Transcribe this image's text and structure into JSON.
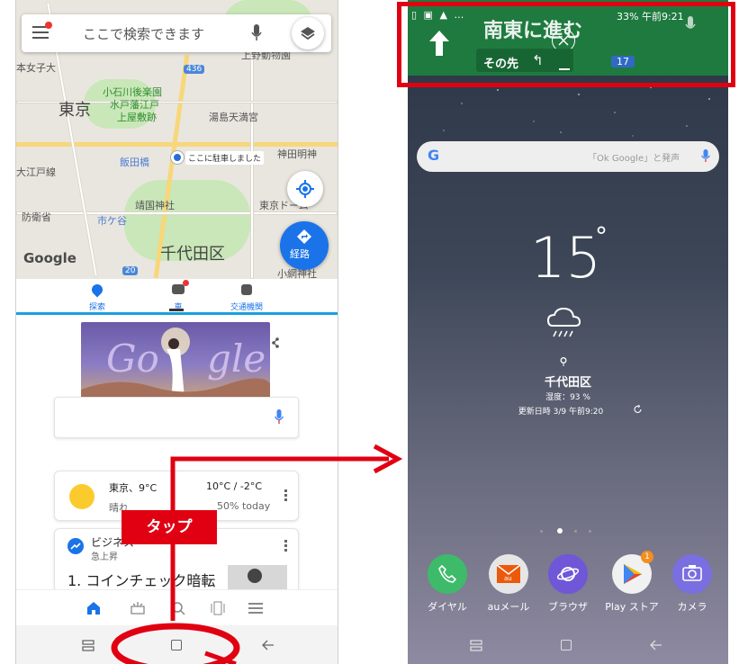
{
  "maps": {
    "search_placeholder": "ここで検索できます",
    "labels": {
      "tokyo": "東京",
      "chiyoda": "千代田区",
      "koishikawa": "小石川後楽園",
      "mito": "水戸藩江戸",
      "yashiki": "上屋敷跡",
      "yushima": "湯島天満宮",
      "kanda": "神田明神",
      "parked": "ここに駐車しました",
      "yasukuni": "靖国神社",
      "tokyo_dome": "東京ドーム",
      "boeisho": "防衛省",
      "ichigaya": "市ケ谷",
      "iidabashi": "飯田橋",
      "oedo": "大江戸線",
      "ueno": "上野動物園",
      "joshi": "本女子大",
      "obanashi": "小網神社",
      "route_436": "436",
      "route_20": "20",
      "google": "Google",
      "directions": "経路"
    },
    "tabs": [
      {
        "label": "探索",
        "icon": "explore-icon",
        "color": "#1a73e8"
      },
      {
        "label": "車",
        "icon": "car-icon",
        "color": "#1a73e8"
      },
      {
        "label": "交通機関",
        "icon": "transit-icon",
        "color": "#1a73e8"
      }
    ]
  },
  "google_app": {
    "weather": {
      "city": "東京、9°C",
      "temps": "10°C / -2°C",
      "cond": "晴れ",
      "rain": "50% today"
    },
    "trend": {
      "title": "ビジネス",
      "sub": "急上昇",
      "item": "1. コインチェック暗転"
    }
  },
  "annotation": {
    "tap_label": "タップ"
  },
  "home": {
    "status": "33% 午前9:21",
    "nav_title": "南東に進む",
    "nav_next": "その先",
    "nav_badge": "17",
    "search_hint": "「Ok Google」と発声",
    "temp": "15",
    "degree": "°",
    "location": "千代田区",
    "humidity": "湿度：93 %",
    "updated": "更新日時 3/9 午前9:20",
    "apps": [
      {
        "label": "ダイヤル",
        "icon": "phone-icon",
        "color": "#3dbb6a"
      },
      {
        "label": "auメール",
        "icon": "au-mail-icon",
        "color": "#e6e6e6"
      },
      {
        "label": "ブラウザ",
        "icon": "browser-icon",
        "color": "#6f57d8"
      },
      {
        "label": "Play ストア",
        "icon": "play-store-icon",
        "color": "#f1f1f1"
      },
      {
        "label": "カメラ",
        "icon": "camera-icon",
        "color": "#7a6fe0"
      }
    ]
  },
  "colors": {
    "accent_red": "#e00012",
    "nav_green": "#1f7a3f",
    "maps_blue": "#1a73e8"
  }
}
